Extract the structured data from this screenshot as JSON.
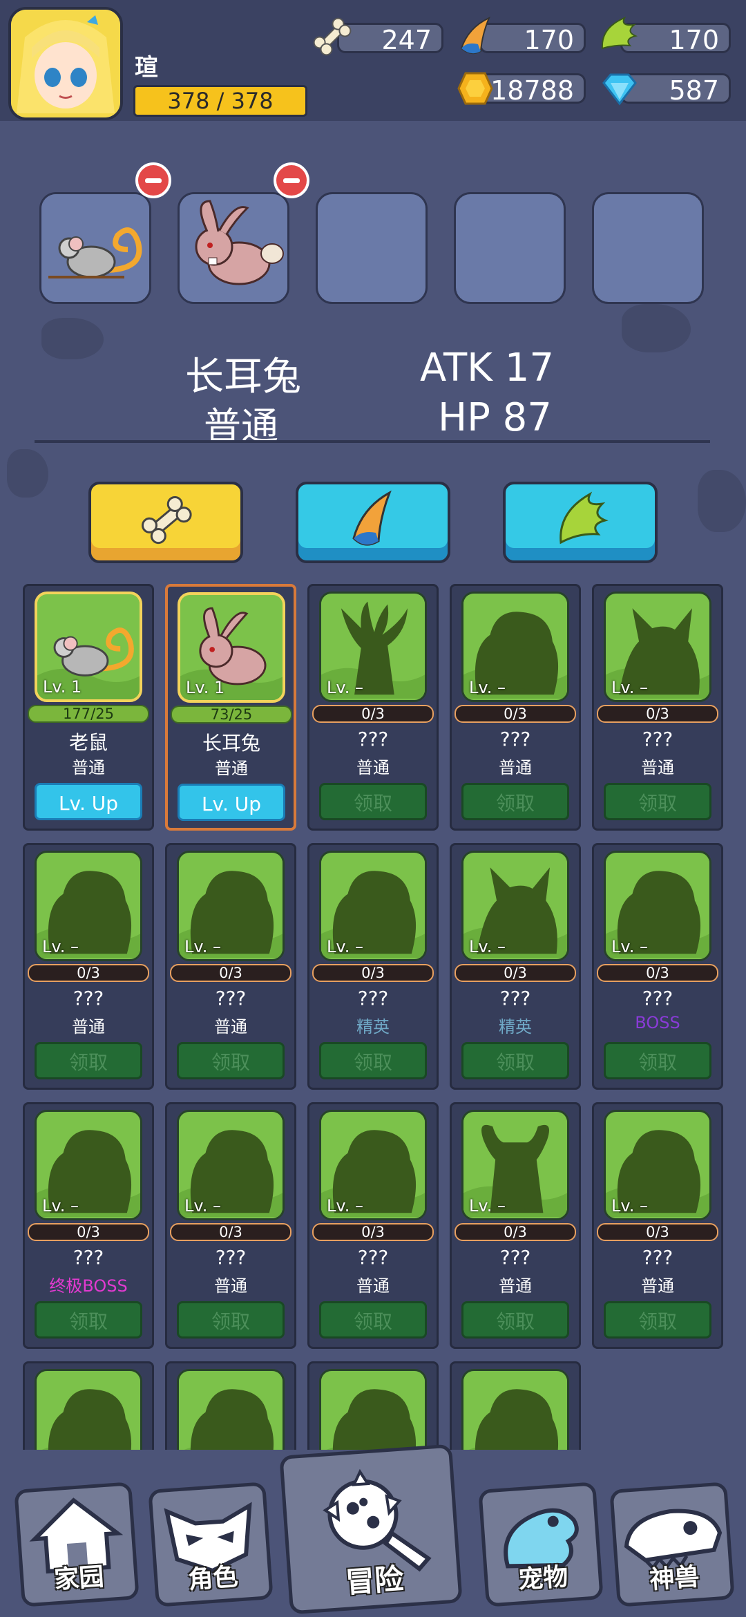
{
  "player": {
    "name": "瑄",
    "hp": "378 / 378"
  },
  "resources": {
    "bone": "247",
    "horn": "170",
    "wing": "170",
    "gold": "18788",
    "gem": "587"
  },
  "selected": {
    "name": "长耳兔",
    "rarity": "普通",
    "atk": "ATK  17",
    "hp": "HP  87"
  },
  "pets": [
    {
      "lv": "Lv. 1",
      "progress": "177/25",
      "name": "老鼠",
      "rarity": "普通",
      "button": "Lv. Up",
      "owned": true,
      "art": "rat"
    },
    {
      "lv": "Lv. 1",
      "progress": "73/25",
      "name": "长耳兔",
      "rarity": "普通",
      "button": "Lv. Up",
      "owned": true,
      "art": "rabbit"
    },
    {
      "lv": "Lv. –",
      "progress": "0/3",
      "name": "???",
      "rarity": "普通",
      "button": "领取",
      "owned": false,
      "art": "deer"
    },
    {
      "lv": "Lv. –",
      "progress": "0/3",
      "name": "???",
      "rarity": "普通",
      "button": "领取",
      "owned": false,
      "art": "blob"
    },
    {
      "lv": "Lv. –",
      "progress": "0/3",
      "name": "???",
      "rarity": "普通",
      "button": "领取",
      "owned": false,
      "art": "fox"
    },
    {
      "lv": "Lv. –",
      "progress": "0/3",
      "name": "???",
      "rarity": "普通",
      "button": "领取",
      "owned": false,
      "art": "blob"
    },
    {
      "lv": "Lv. –",
      "progress": "0/3",
      "name": "???",
      "rarity": "普通",
      "button": "领取",
      "owned": false,
      "art": "blob"
    },
    {
      "lv": "Lv. –",
      "progress": "0/3",
      "name": "???",
      "rarity": "精英",
      "button": "领取",
      "owned": false,
      "art": "blob"
    },
    {
      "lv": "Lv. –",
      "progress": "0/3",
      "name": "???",
      "rarity": "精英",
      "button": "领取",
      "owned": false,
      "art": "fox"
    },
    {
      "lv": "Lv. –",
      "progress": "0/3",
      "name": "???",
      "rarity": "BOSS",
      "button": "领取",
      "owned": false,
      "art": "blob"
    },
    {
      "lv": "Lv. –",
      "progress": "0/3",
      "name": "???",
      "rarity": "终极BOSS",
      "button": "领取",
      "owned": false,
      "art": "blob"
    },
    {
      "lv": "Lv. –",
      "progress": "0/3",
      "name": "???",
      "rarity": "普通",
      "button": "领取",
      "owned": false,
      "art": "blob"
    },
    {
      "lv": "Lv. –",
      "progress": "0/3",
      "name": "???",
      "rarity": "普通",
      "button": "领取",
      "owned": false,
      "art": "blob"
    },
    {
      "lv": "Lv. –",
      "progress": "0/3",
      "name": "???",
      "rarity": "普通",
      "button": "领取",
      "owned": false,
      "art": "bull"
    },
    {
      "lv": "Lv. –",
      "progress": "0/3",
      "name": "???",
      "rarity": "普通",
      "button": "领取",
      "owned": false,
      "art": "blob"
    },
    {
      "lv": "",
      "progress": "",
      "name": "",
      "rarity": "",
      "button": "",
      "owned": false,
      "art": "blob"
    },
    {
      "lv": "",
      "progress": "",
      "name": "",
      "rarity": "",
      "button": "",
      "owned": false,
      "art": "blob"
    },
    {
      "lv": "",
      "progress": "",
      "name": "",
      "rarity": "",
      "button": "",
      "owned": false,
      "art": "blob"
    },
    {
      "lv": "",
      "progress": "",
      "name": "",
      "rarity": "",
      "button": "",
      "owned": false,
      "art": "blob"
    }
  ],
  "rarity_colors": {
    "普通": "#ffffff",
    "精英": "#6fa8c6",
    "BOSS": "#8a3bd8",
    "终极BOSS": "#e23ad0"
  },
  "nav": {
    "home": "家园",
    "role": "角色",
    "adventure": "冒险",
    "pet": "宠物",
    "beast": "神兽"
  }
}
